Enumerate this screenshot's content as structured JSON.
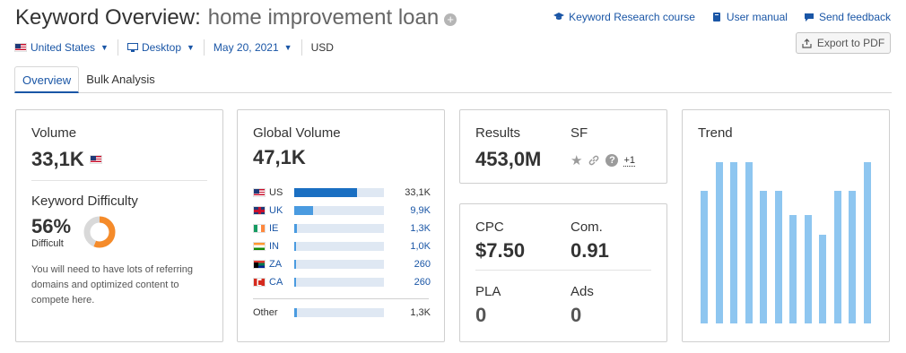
{
  "header": {
    "title": "Keyword Overview:",
    "keyword": "home improvement loan",
    "links": [
      "Keyword Research course",
      "User manual",
      "Send feedback"
    ],
    "export_label": "Export to PDF"
  },
  "filters": {
    "country": "United States",
    "device": "Desktop",
    "date": "May 20, 2021",
    "currency": "USD"
  },
  "tabs": [
    "Overview",
    "Bulk Analysis"
  ],
  "volume": {
    "label": "Volume",
    "value": "33,1K"
  },
  "difficulty": {
    "label": "Keyword Difficulty",
    "percent": "56%",
    "percent_value": 56,
    "level": "Difficult",
    "description": "You will need to have lots of referring domains and optimized content to compete here.",
    "color": "#f58b2a"
  },
  "global_volume": {
    "label": "Global Volume",
    "value": "47,1K",
    "rows": [
      {
        "code": "US",
        "value": "33,1K",
        "share": 0.7
      },
      {
        "code": "UK",
        "value": "9,9K",
        "share": 0.21
      },
      {
        "code": "IE",
        "value": "1,3K",
        "share": 0.03
      },
      {
        "code": "IN",
        "value": "1,0K",
        "share": 0.02
      },
      {
        "code": "ZA",
        "value": "260",
        "share": 0.01
      },
      {
        "code": "CA",
        "value": "260",
        "share": 0.01
      }
    ],
    "other": {
      "label": "Other",
      "value": "1,3K",
      "share": 0.03
    }
  },
  "results": {
    "label": "Results",
    "value": "453,0M"
  },
  "sf": {
    "label": "SF",
    "more": "+1",
    "icons": [
      "star-icon",
      "link-icon",
      "question-icon"
    ]
  },
  "cpc": {
    "label": "CPC",
    "value": "$7.50"
  },
  "com": {
    "label": "Com.",
    "value": "0.91"
  },
  "pla": {
    "label": "PLA",
    "value": "0"
  },
  "ads": {
    "label": "Ads",
    "value": "0"
  },
  "trend": {
    "label": "Trend",
    "values": [
      0.82,
      1.0,
      1.0,
      1.0,
      0.82,
      0.82,
      0.67,
      0.67,
      0.55,
      0.82,
      0.82,
      1.0
    ],
    "color": "#8ec6f0"
  }
}
